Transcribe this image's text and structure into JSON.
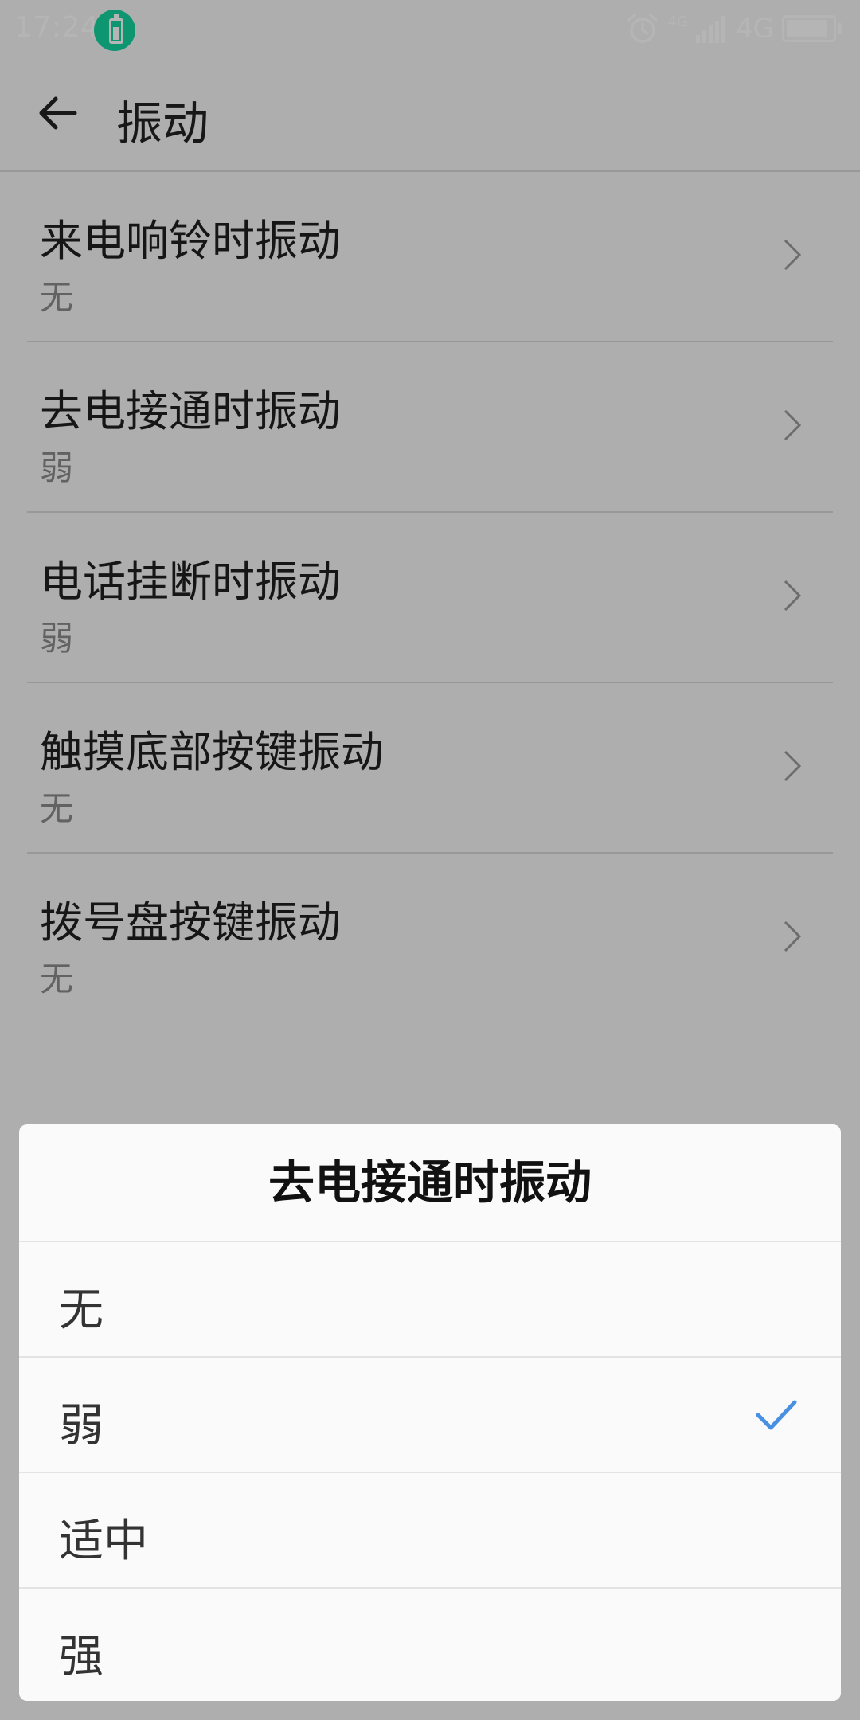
{
  "status_bar": {
    "time": "17:24",
    "network_small": "4G",
    "network": "4G",
    "battery_level": 0.9
  },
  "app_bar": {
    "title": "振动"
  },
  "settings": {
    "items": [
      {
        "label": "来电响铃时振动",
        "value": "无"
      },
      {
        "label": "去电接通时振动",
        "value": "弱"
      },
      {
        "label": "电话挂断时振动",
        "value": "弱"
      },
      {
        "label": "触摸底部按键振动",
        "value": "无"
      },
      {
        "label": "拨号盘按键振动",
        "value": "无"
      }
    ]
  },
  "dialog": {
    "title": "去电接通时振动",
    "options": [
      {
        "label": "无",
        "selected": false
      },
      {
        "label": "弱",
        "selected": true
      },
      {
        "label": "适中",
        "selected": false
      },
      {
        "label": "强",
        "selected": false
      }
    ]
  },
  "colors": {
    "accent": "#4a90e2",
    "battery_saver": "#14d3a0"
  },
  "icons": {
    "back": "arrow-left-icon",
    "chevron": "chevron-right-icon",
    "check": "check-icon",
    "alarm": "alarm-clock-icon",
    "signal": "signal-icon",
    "battery": "battery-icon"
  }
}
